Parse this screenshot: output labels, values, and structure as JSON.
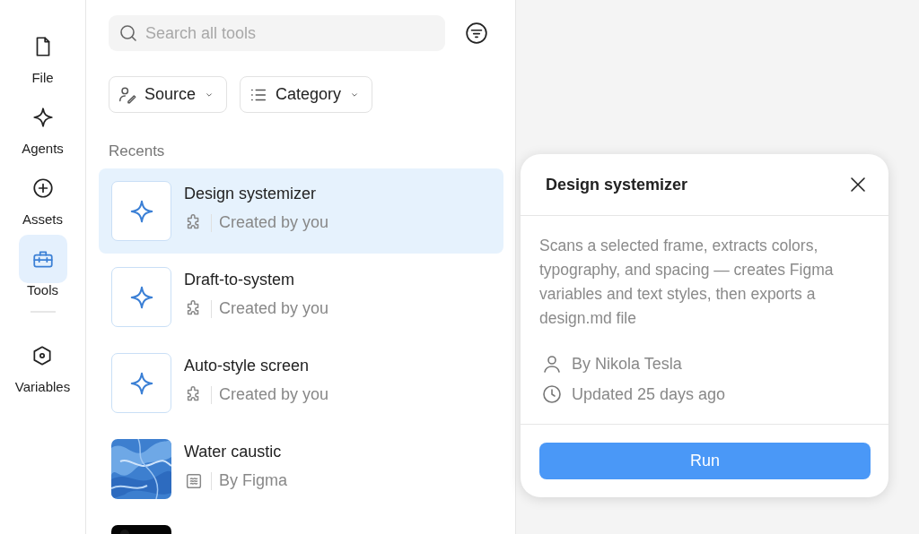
{
  "rail": [
    {
      "label": "File",
      "selected": false
    },
    {
      "label": "Agents",
      "selected": false
    },
    {
      "label": "Assets",
      "selected": false
    },
    {
      "label": "Tools",
      "selected": true
    },
    {
      "label": "Variables",
      "selected": false
    }
  ],
  "search": {
    "placeholder": "Search all tools"
  },
  "filters": [
    {
      "label": "Source"
    },
    {
      "label": "Category"
    }
  ],
  "section_title": "Recents",
  "tools": [
    {
      "kind": "plugin",
      "title": "Design systemizer",
      "source": "Created by you",
      "selected": true
    },
    {
      "kind": "plugin",
      "title": "Draft-to-system",
      "source": "Created by you",
      "selected": false
    },
    {
      "kind": "plugin",
      "title": "Auto-style screen",
      "source": "Created by you",
      "selected": false
    },
    {
      "kind": "shader",
      "title": "Water caustic",
      "source": "By Figma",
      "selected": false
    },
    {
      "kind": "picture",
      "selected": false
    }
  ],
  "popover": {
    "title": "Design systemizer",
    "description": "Scans a selected frame, extracts colors, typography, and spacing — creates Figma variables and text styles, then exports a design.md file",
    "author": "By Nikola Tesla",
    "updated": "Updated 25 days ago",
    "action": "Run"
  }
}
